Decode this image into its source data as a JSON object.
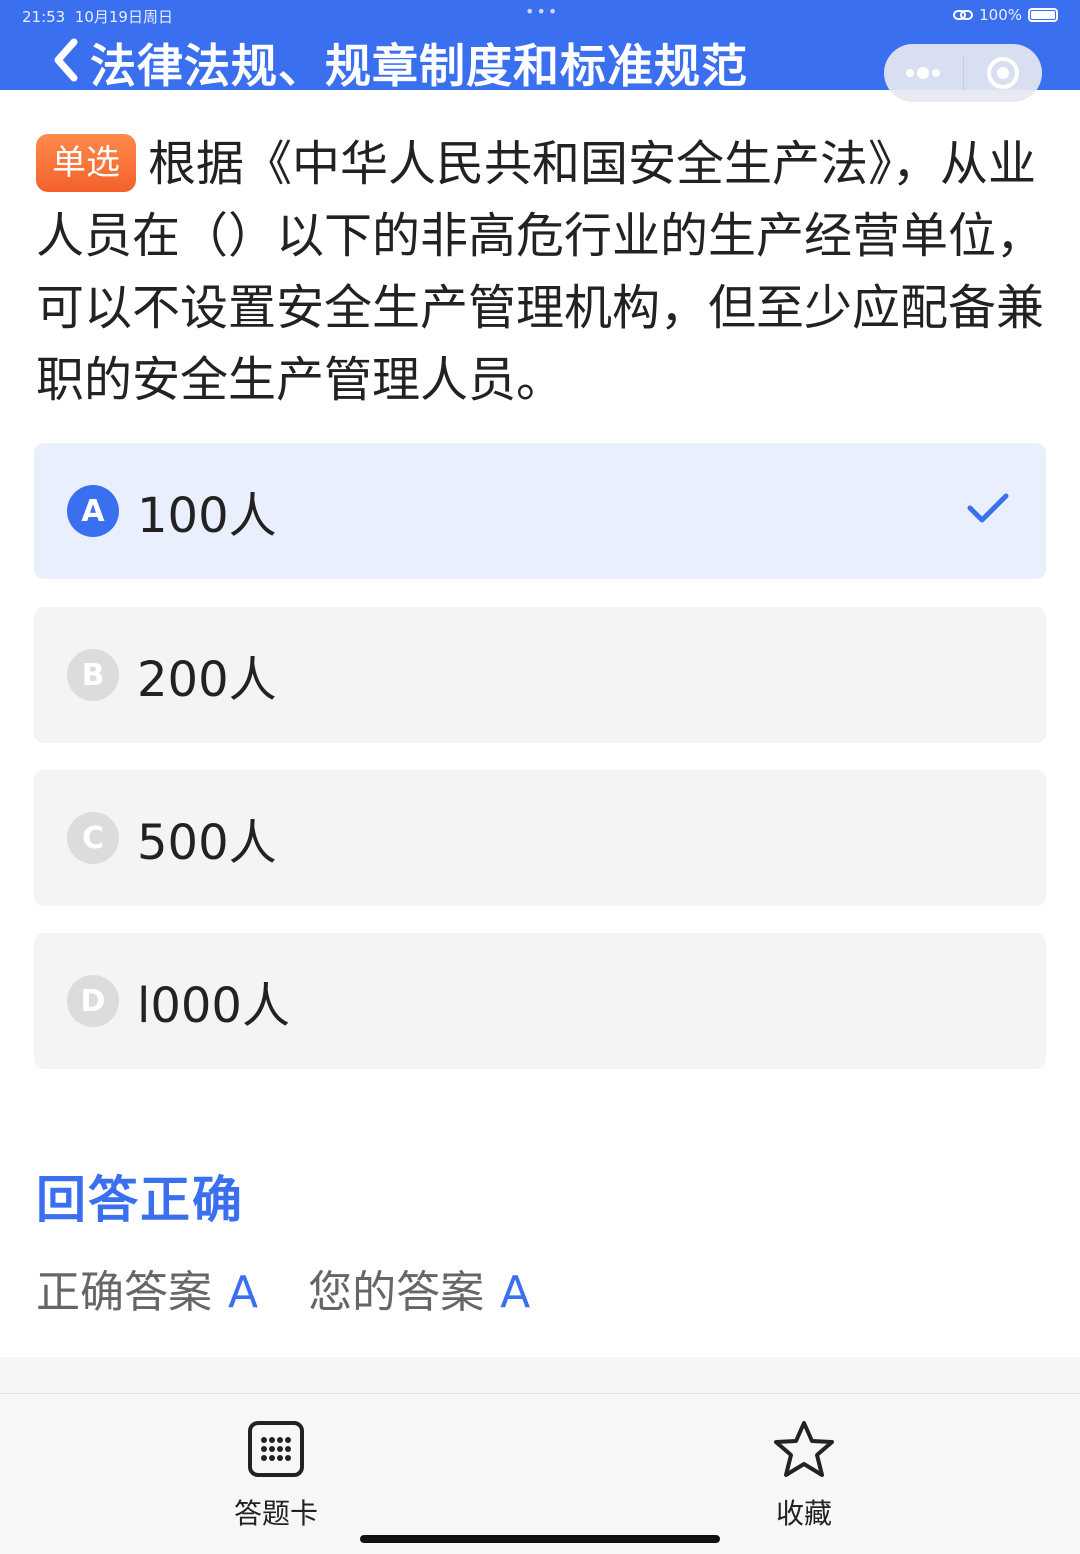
{
  "status_bar": {
    "time": "21:53",
    "date": "10月19日周日",
    "dots": "•••",
    "battery": "100%"
  },
  "header": {
    "title": "法律法规、规章制度和标准规范",
    "background_color": "#3a6ff0"
  },
  "question": {
    "type_tag": "单选",
    "text": "根据《中华人民共和国安全生产法》，从业人员在（）以下的非高危行业的生产经营单位，可以不设置安全生产管理机构，但至少应配备兼职的安全生产管理人员。"
  },
  "options": [
    {
      "letter": "A",
      "text": "100人",
      "selected": true
    },
    {
      "letter": "B",
      "text": "200人",
      "selected": false
    },
    {
      "letter": "C",
      "text": "500人",
      "selected": false
    },
    {
      "letter": "D",
      "text": "l000人",
      "selected": false
    }
  ],
  "result": {
    "title": "回答正确",
    "correct_label": "正确答案",
    "correct_value": "A",
    "your_label": "您的答案",
    "your_value": "A"
  },
  "bottom_bar": {
    "answer_card_label": "答题卡",
    "favorite_label": "收藏"
  },
  "colors": {
    "accent": "#3a6ff0",
    "tag_orange": "#f4612b",
    "selected_bg": "#e9effd",
    "option_bg": "#f4f4f4"
  }
}
